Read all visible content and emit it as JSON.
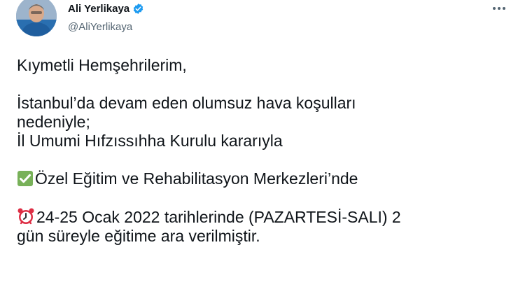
{
  "author": {
    "name": "Ali Yerlikaya",
    "handle": "@AliYerlikaya",
    "verified": true,
    "avatar_icon": "profile-photo"
  },
  "menu_icon": "more-horizontal-icon",
  "tweet": {
    "greeting": "Kıymetli Hemşehrilerim,",
    "line1": "İstanbul’da devam eden olumsuz hava koşulları",
    "line2": "nedeniyle;",
    "line3": "İl Umumi Hıfzıssıhha Kurulu kararıyla",
    "item1_icon": "check-mark-button-icon",
    "item1_text": "Özel Eğitim ve Rehabilitasyon Merkezleri’nde",
    "item2_icon": "alarm-clock-icon",
    "item2_text": "24-25 Ocak 2022 tarihlerinde (PAZARTESİ-SALI) 2",
    "item2_cont": "gün süreyle eğitime ara verilmiştir."
  },
  "colors": {
    "verified_blue": "#1d9bf0",
    "text": "#0f1419",
    "secondary": "#536471",
    "check_green": "#78b159",
    "alarm_red": "#dd2e44"
  }
}
